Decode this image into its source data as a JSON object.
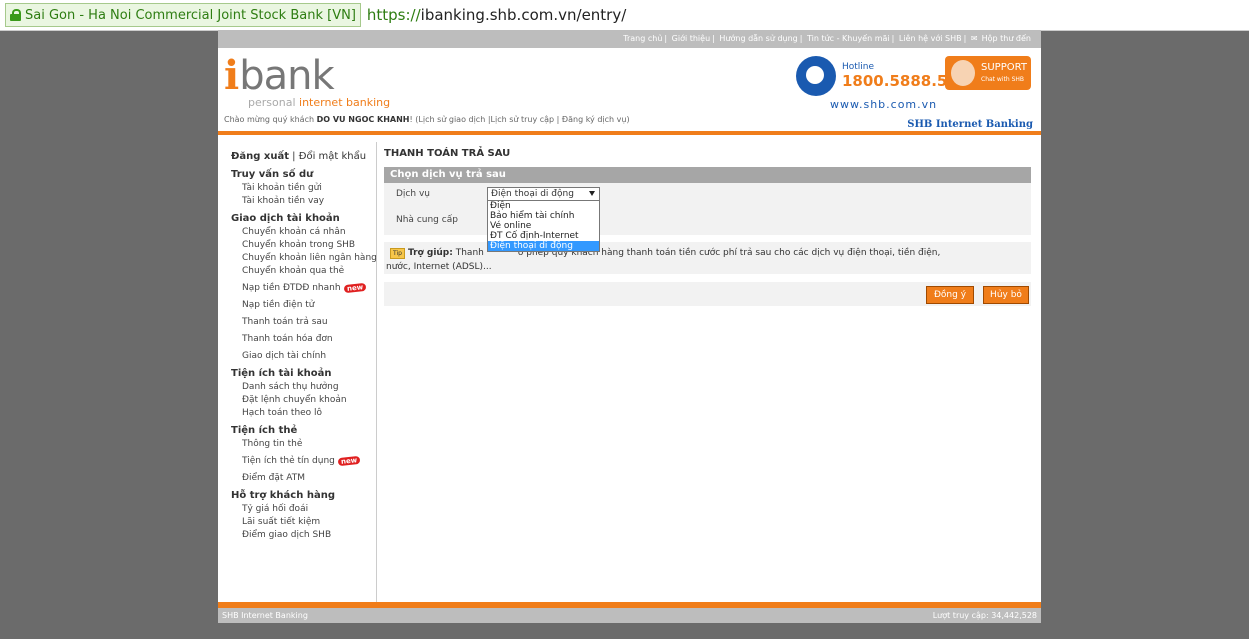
{
  "browser": {
    "cert_owner": "Sai Gon - Ha Noi Commercial Joint Stock Bank [VN]",
    "url_proto": "https://",
    "url_host": "ibanking.shb.com.vn",
    "url_path": "/entry/"
  },
  "topnav": [
    "Trang chủ",
    "Giới thiệu",
    "Hướng dẫn sử dụng",
    "Tin tức - Khuyến mãi",
    "Liên hệ với SHB",
    "Hộp thư đến"
  ],
  "header": {
    "logo_i": "i",
    "logo_bank": "bank",
    "tagline_a": "personal",
    "tagline_b": "internet banking",
    "hotline_label": "Hotline",
    "hotline_number": "1800.5888.56",
    "website": "www.shb.com.vn",
    "support_label": "SUPPORT",
    "support_sub": "Chat with SHB",
    "welcome_prefix": "Chào mừng quý khách",
    "user_name": "DO VU NGOC KHANH",
    "welcome_links": "! (Lịch sử giao dịch |Lịch sử truy cập | Đăng ký dịch vụ)",
    "brand": "SHB Internet Banking"
  },
  "sidebar": {
    "logout": "Đăng xuất",
    "change_pw": "Đổi mật khẩu",
    "groups": [
      {
        "title": "Truy vấn số dư",
        "items": [
          "Tài khoản tiền gửi",
          "Tài khoản tiền vay"
        ]
      },
      {
        "title": "Giao dịch tài khoản",
        "items": [
          "Chuyển khoản cá nhân",
          "Chuyển khoản trong SHB",
          "Chuyển khoản liên ngân hàng",
          "Chuyển khoản qua thẻ",
          "Nạp tiền ĐTDĐ nhanh",
          "Nạp tiền điện tử",
          "Thanh toán trả sau",
          "Thanh toán hóa đơn",
          "Giao dịch tài chính"
        ]
      },
      {
        "title": "Tiện ích tài khoản",
        "items": [
          "Danh sách thụ hưởng",
          "Đặt lệnh chuyển khoản",
          "Hạch toán theo lô"
        ]
      },
      {
        "title": "Tiện ích thẻ",
        "items": [
          "Thông tin thẻ",
          "Tiện ích thẻ tín dụng",
          "Điểm đặt ATM"
        ]
      },
      {
        "title": "Hỗ trợ khách hàng",
        "items": [
          "Tỷ giá hối đoái",
          "Lãi suất tiết kiệm",
          "Điểm giao dịch SHB"
        ]
      }
    ],
    "new_badge": "new"
  },
  "main": {
    "title": "THANH TOÁN TRẢ SAU",
    "section": "Chọn dịch vụ trả sau",
    "service_label": "Dịch vụ",
    "provider_label": "Nhà cung cấp",
    "service_selected": "Điện thoại di động",
    "service_options": [
      "Điện",
      "Bảo hiểm tài chính",
      "Vé online",
      "ĐT Cố định-Internet",
      "Điện thoại di động"
    ],
    "help_tip": "Tip",
    "help_label": "Trợ giúp:",
    "help_text_a": "Thanh",
    "help_text_b": "o phép quý khách hàng thanh toán tiền cước phí trả sau cho các dịch vụ điện thoại, tiền điện,",
    "help_text_c": "nước, Internet (ADSL)...",
    "ok": "Đồng ý",
    "cancel": "Hủy bỏ"
  },
  "footer": {
    "left": "SHB Internet Banking",
    "right": "Lượt truy cập: 34,442,528"
  }
}
